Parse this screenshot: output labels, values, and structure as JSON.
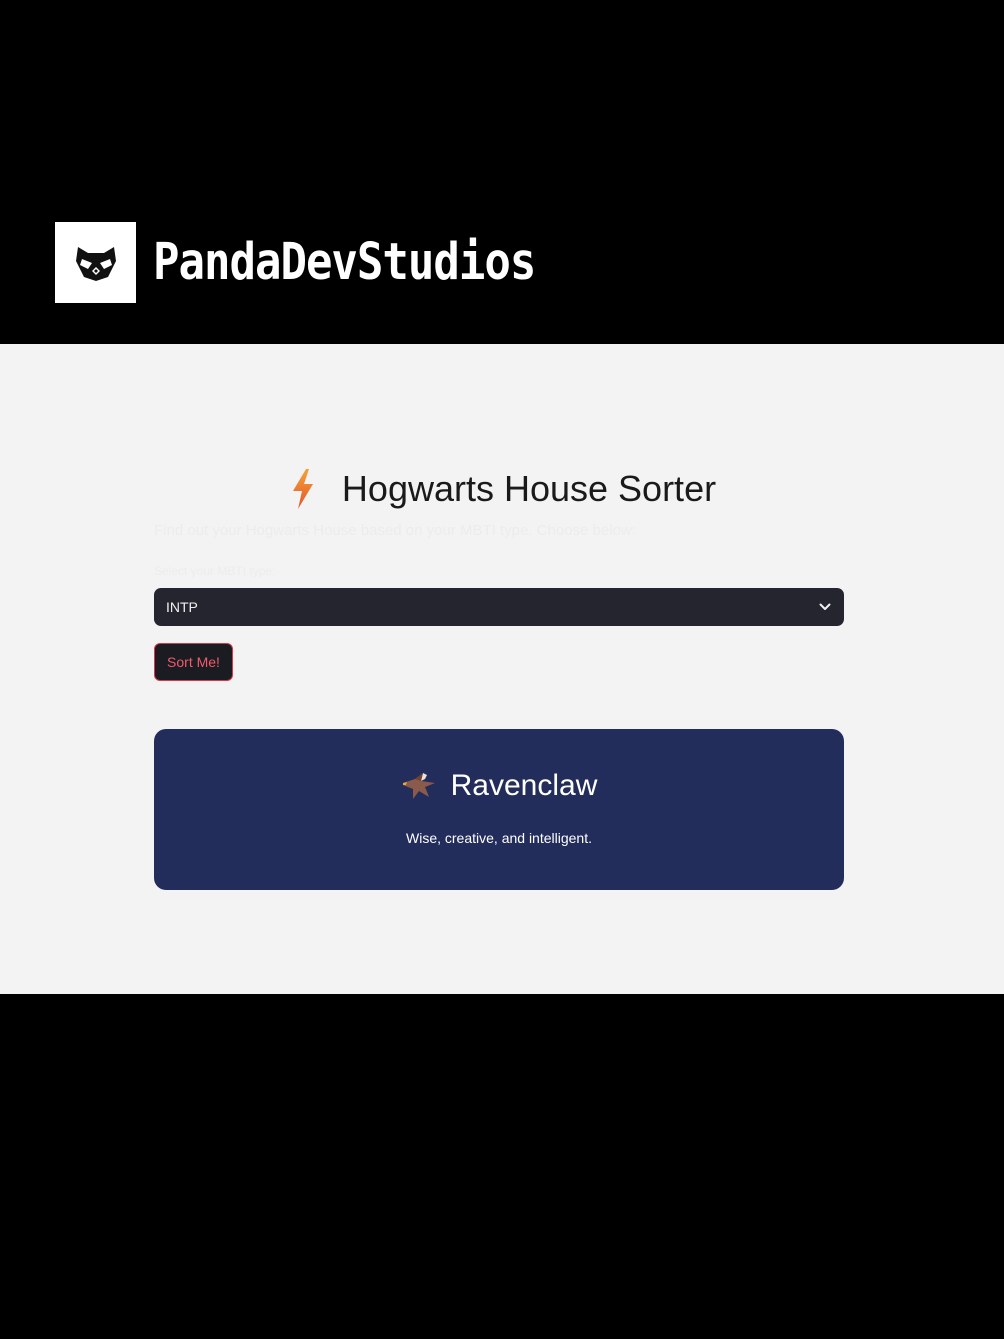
{
  "brand": {
    "name": "PandaDevStudios",
    "logo_icon": "panda-mask-icon"
  },
  "app": {
    "title_icon": "lightning-bolt-icon",
    "title": "Hogwarts House Sorter",
    "subtitle": "Find out your Hogwarts House based on your MBTI type. Choose below:",
    "select_label": "Select your MBTI type:",
    "select_value": "INTP",
    "select_icon": "chevron-down-icon",
    "sort_button_label": "Sort Me!"
  },
  "result": {
    "icon": "eagle-icon",
    "house": "Ravenclaw",
    "description": "Wise, creative, and intelligent."
  },
  "colors": {
    "app_background": "#f3f3f3",
    "select_background": "#24252f",
    "button_border": "#d9364a",
    "button_text": "#f05a6a",
    "result_background": "#232d5c",
    "bolt_color": "#f28a2e"
  }
}
